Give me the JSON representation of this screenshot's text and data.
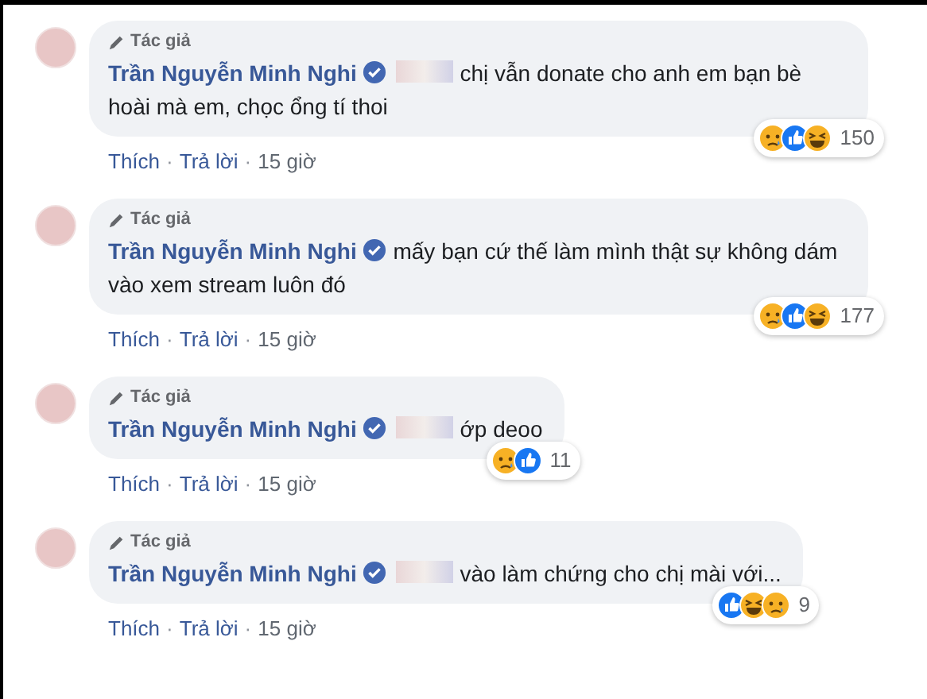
{
  "comments": [
    {
      "badge": "Tác giả",
      "author": "Trần Nguyễn Minh Nghi",
      "verified": true,
      "redacted": true,
      "text": "chị vẫn donate cho anh em bạn bè hoài mà em, chọc ổng tí thoi",
      "actions": [
        "Thích",
        "·",
        "Trả lời",
        "·",
        "15 giờ"
      ],
      "reactions": [
        {
          "kind": "sad"
        },
        {
          "kind": "like"
        },
        {
          "kind": "haha"
        }
      ],
      "count": "150"
    },
    {
      "badge": "Tác giả",
      "author": "Trần Nguyễn Minh Nghi",
      "verified": true,
      "redacted": false,
      "text": "mấy bạn cứ thế làm mình thật sự không dám vào xem stream luôn đó",
      "actions": [
        "Thích",
        "·",
        "Trả lời",
        "·",
        "15 giờ"
      ],
      "reactions": [
        {
          "kind": "sad"
        },
        {
          "kind": "like"
        },
        {
          "kind": "haha"
        }
      ],
      "count": "177"
    },
    {
      "badge": "Tác giả",
      "author": "Trần Nguyễn Minh Nghi",
      "verified": true,
      "redacted": true,
      "text": "ớp deoo",
      "actions": [
        "Thích",
        "·",
        "Trả lời",
        "·",
        "15 giờ"
      ],
      "reactions": [
        {
          "kind": "sad"
        },
        {
          "kind": "like"
        }
      ],
      "count": "11"
    },
    {
      "badge": "Tác giả",
      "author": "Trần Nguyễn Minh Nghi",
      "verified": true,
      "redacted": true,
      "text": "vào làm chứng cho chị mài với...",
      "actions": [
        "Thích",
        "·",
        "Trả lời",
        "·",
        "15 giờ"
      ],
      "reactions": [
        {
          "kind": "like"
        },
        {
          "kind": "haha"
        },
        {
          "kind": "sad"
        }
      ],
      "count": "9"
    }
  ]
}
